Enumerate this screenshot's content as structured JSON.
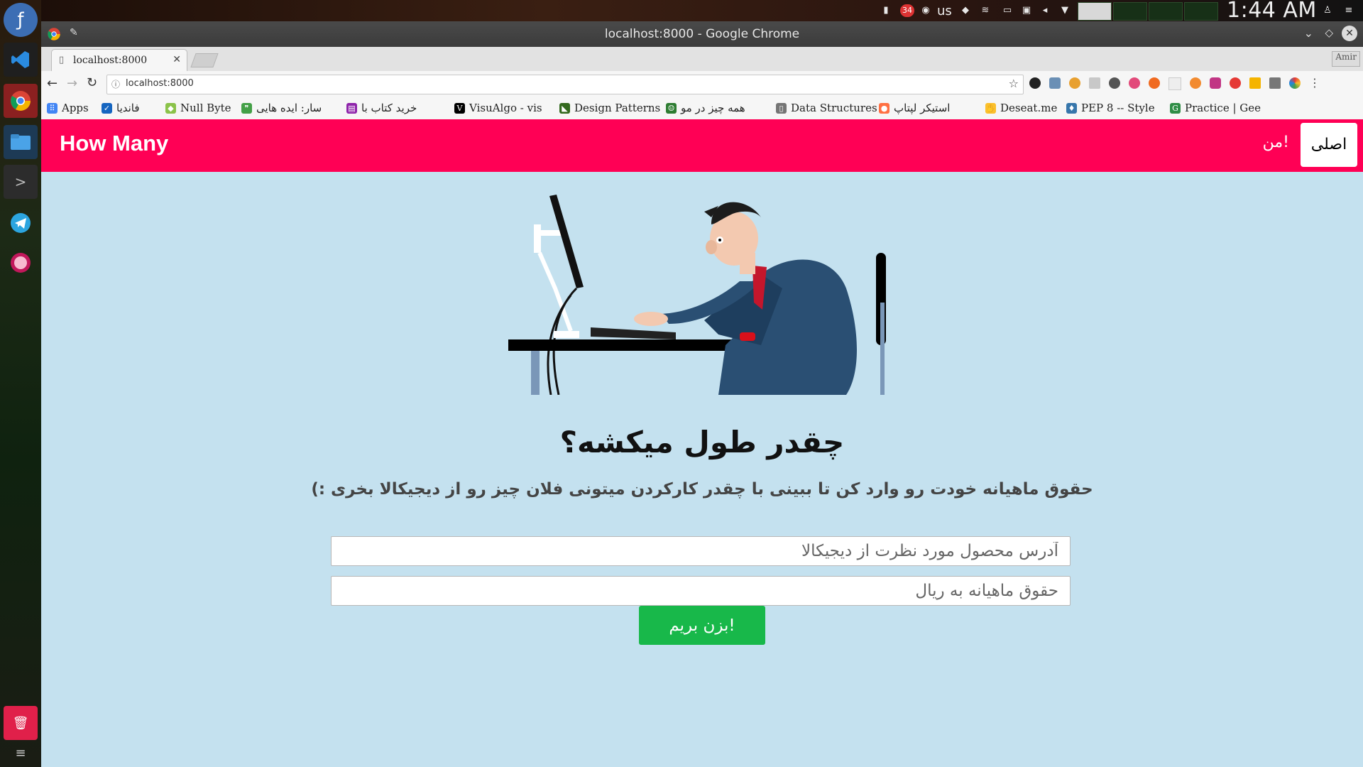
{
  "system": {
    "clock": "1:44 AM",
    "keyboard_layout": "us",
    "notification_count": "34"
  },
  "browser": {
    "window_title": "localhost:8000 - Google Chrome",
    "tab_title": "localhost:8000",
    "url": "localhost:8000",
    "profile": "Amir",
    "bookmarks": [
      {
        "label": "Apps",
        "icon": "apps-grid-icon",
        "color": "#4285f4"
      },
      {
        "label": "فانديا",
        "icon": "bookmark-check-icon",
        "color": "#1565c0"
      },
      {
        "label": "Null Byte",
        "icon": "nullbyte-icon",
        "color": "#8bc34a"
      },
      {
        "label": "سار: ایده هایی ",
        "icon": "quote-icon",
        "color": "#43a047"
      },
      {
        "label": "خرید کتاب با",
        "icon": "book-icon",
        "color": "#8e24aa"
      },
      {
        "label": "VisuAlgo - vis",
        "icon": "visualgo-icon",
        "color": "#000000"
      },
      {
        "label": "Design Patterns",
        "icon": "design-icon",
        "color": "#33691e"
      },
      {
        "label": "همه چیز در مو",
        "icon": "alien-icon",
        "color": "#2e7d32"
      },
      {
        "label": "Data Structures",
        "icon": "doc-icon",
        "color": "#757575"
      },
      {
        "label": "استیکر لپتاپ",
        "icon": "sticker-icon",
        "color": "#ff7043"
      },
      {
        "label": "Deseat.me",
        "icon": "hand-icon",
        "color": "#fbc02d"
      },
      {
        "label": "PEP 8 -- Style",
        "icon": "python-icon",
        "color": "#3776ab"
      },
      {
        "label": "Practice | Gee",
        "icon": "gfg-icon",
        "color": "#2f8d46"
      }
    ]
  },
  "page": {
    "brand": "How Many",
    "nav": [
      {
        "label": "اصلی",
        "active": true
      },
      {
        "label": "من!",
        "active": false
      }
    ],
    "headline": "چقدر طول میکشه؟",
    "subline": "حقوق ماهیانه خودت رو وارد کن تا ببینی با چقدر کارکردن میتونی فلان چیز رو از دیجیکالا بخری :)",
    "product_url_placeholder": "آدرس محصول مورد نظرت از دیجیکالا",
    "salary_placeholder": "حقوق ماهیانه به ریال",
    "submit_label": "بزن بریم!",
    "colors": {
      "navbar": "#ff0055",
      "background": "#c4e1ef",
      "button": "#18b84a"
    }
  },
  "dock": {
    "items": [
      "fedora-logo-icon",
      "vscode-icon",
      "chrome-icon",
      "files-icon",
      "terminal-icon",
      "telegram-icon",
      "pinta-icon",
      "trash-icon",
      "menu-icon"
    ]
  }
}
